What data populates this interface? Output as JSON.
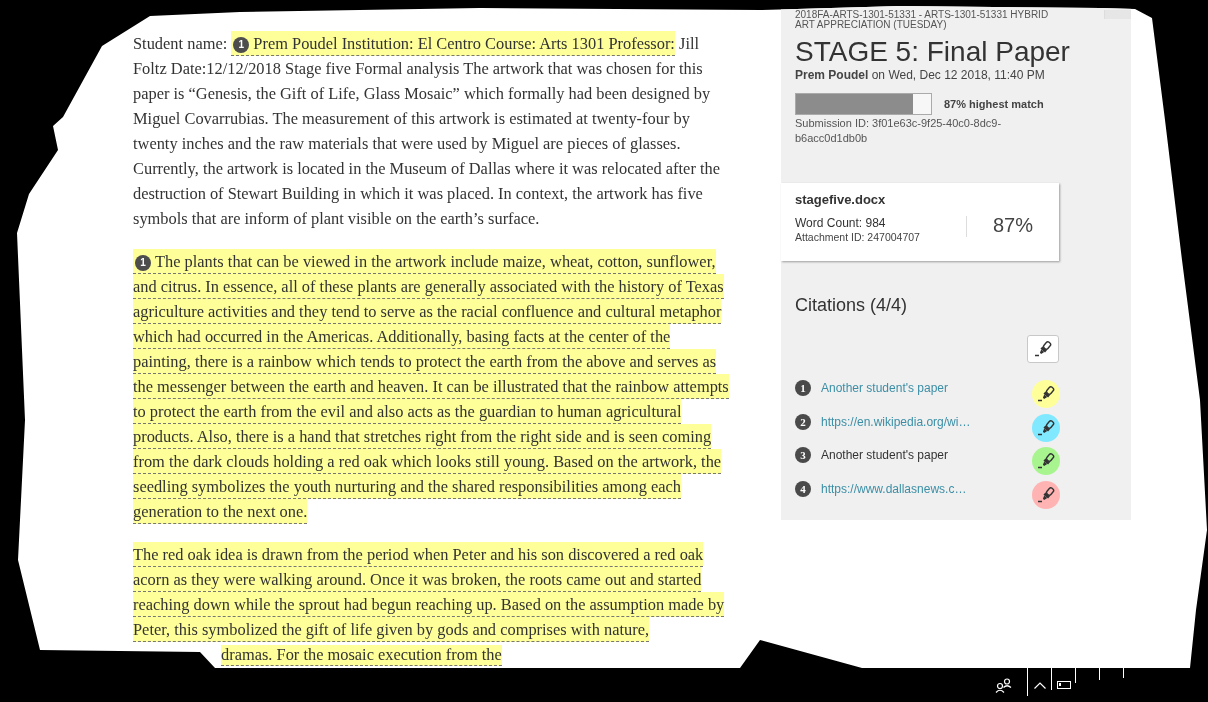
{
  "document": {
    "paragraphs": [
      {
        "segments": [
          {
            "text": "Student name: ",
            "highlighted": false
          },
          {
            "text": "Prem Poudel Institution: El Centro Course: Arts 1301 Professor:",
            "highlighted": true,
            "badge": "1"
          },
          {
            "text": " Jill Foltz Date:12/12/2018 Stage five Formal analysis The artwork that was chosen for this paper is “Genesis, the Gift of Life, Glass Mosaic” which formally had been designed by Miguel Covarrubias. The measurement of this artwork is estimated at twenty-four by twenty inches and the raw materials that were used by Miguel are pieces of glasses. Currently, the artwork is located in the Museum of Dallas where it was relocated after the destruction of Stewart Building in which it was placed. In context, the artwork has five symbols that are inform of plant visible on the earth’s surface.",
            "highlighted": false
          }
        ]
      },
      {
        "segments": [
          {
            "text": "The plants that can be viewed in the artwork include maize, wheat, cotton, sunflower, and citrus. In essence, all of these plants are generally associated with the history of Texas agriculture activities and they tend to serve as the racial confluence and cultural metaphor which had occurred in the Americas. Additionally, basing facts at the center of the painting, there is a rainbow which tends to protect the earth from the above and serves as the messenger between the earth and heaven. It can be illustrated that the rainbow attempts to protect the earth from the evil and also acts as the guardian to human agricultural products. Also, there is a hand that stretches right from the right side and is seen coming from the dark clouds holding a red oak which looks still young. Based on the artwork, the seedling symbolizes the youth nurturing and the shared responsibilities among each generation to the next one.",
            "highlighted": true,
            "badge": "1"
          }
        ]
      },
      {
        "segments": [
          {
            "text": "The red oak idea is drawn from the period when Peter and his son discovered a red oak acorn as they were walking around. Once it was broken, the roots came out and started reaching down while the sprout had begun reaching up. Based on the assumption made by Peter, this symbolized the gift of life given by gods and comprises with nature,",
            "highlighted": true
          }
        ],
        "cut_line": {
          "text": "dramas. For the mosaic execution from the",
          "highlighted": true
        }
      }
    ]
  },
  "submission": {
    "course": "2018FA-ARTS-1301-51331 - ARTS-1301-51331 HYBRID ART APPRECIATION (TUESDAY)",
    "title": "STAGE 5: Final Paper",
    "byline": "**Prem Poudel** on Wed, Dec 12 2018, 11:40 PM",
    "match": {
      "level": 0.87,
      "label": "87% highest match"
    },
    "submission_id": "Submission ID: 3f01e63c-9f25-40c0-8dc9-b6acc0d1db0b"
  },
  "file": {
    "name": "stagefive.docx",
    "word_count": "Word Count: 984",
    "attachment_id": "Attachment ID: 247004707",
    "score": "87%"
  },
  "citations": {
    "title": "Citations (4/4)",
    "items": [
      {
        "number": "1",
        "label": "Another student's paper",
        "linked": true,
        "color": "#ffff99"
      },
      {
        "number": "2",
        "label": "https://en.wikipedia.org/wi…",
        "linked": true,
        "color": "#80e8ff"
      },
      {
        "number": "3",
        "label": "Another student's paper",
        "linked": false,
        "color": "#a8f590"
      },
      {
        "number": "4",
        "label": "https://www.dallasnews.c…",
        "linked": true,
        "color": "#ffb3b3"
      }
    ]
  }
}
